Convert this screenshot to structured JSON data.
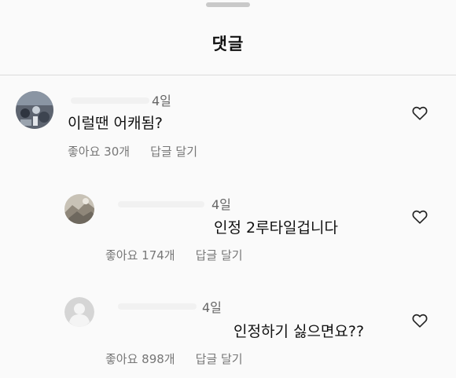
{
  "header": {
    "title": "댓글"
  },
  "comments": [
    {
      "time": "4일",
      "text": "이럴땐 어캐됨?",
      "likes": "좋아요 30개",
      "reply": "답글 달기",
      "avatar": "photo-avatar"
    },
    {
      "time": "4일",
      "text": "인정 2루타일겁니다",
      "likes": "좋아요 174개",
      "reply": "답글 달기",
      "avatar": "photo-avatar"
    },
    {
      "time": "4일",
      "text": "인정하기 싫으면요??",
      "likes": "좋아요 898개",
      "reply": "답글 달기",
      "avatar": "default-avatar"
    }
  ],
  "icons": {
    "like": "heart-outline-icon"
  },
  "colors": {
    "background": "#fafafa",
    "divider": "#dcdcdc",
    "meta_text": "#777777"
  }
}
